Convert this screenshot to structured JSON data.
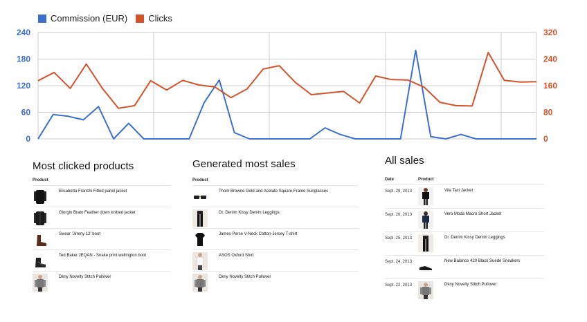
{
  "legend": {
    "commission_label": "Commission (EUR)",
    "clicks_label": "Clicks"
  },
  "colors": {
    "commission": "#3a6fd0",
    "clicks": "#d4522a",
    "grid": "#cccccc"
  },
  "chart_data": {
    "type": "line",
    "x": [
      0,
      1,
      2,
      3,
      4,
      5,
      6,
      7,
      8,
      9,
      10,
      11,
      12,
      13,
      14,
      15,
      16,
      17,
      18,
      19,
      20,
      21,
      22,
      23,
      24,
      25,
      26,
      27,
      28,
      29,
      30,
      31,
      32,
      33
    ],
    "series": [
      {
        "name": "Commission (EUR)",
        "axis": "left",
        "values": [
          0,
          55,
          51,
          43,
          73,
          0,
          35,
          0,
          0,
          0,
          0,
          82,
          133,
          14,
          0,
          0,
          0,
          0,
          0,
          25,
          10,
          0,
          0,
          0,
          0,
          200,
          5,
          0,
          10,
          0,
          0,
          0,
          0,
          0
        ]
      },
      {
        "name": "Clicks",
        "axis": "right",
        "values": [
          175,
          200,
          152,
          225,
          152,
          92,
          100,
          175,
          147,
          176,
          162,
          156,
          124,
          150,
          210,
          220,
          170,
          133,
          138,
          143,
          108,
          189,
          178,
          177,
          156,
          110,
          100,
          99,
          260,
          176,
          171,
          172
        ]
      }
    ],
    "left_axis": {
      "ticks": [
        "0",
        "60",
        "120",
        "180",
        "240"
      ],
      "ylim": [
        0,
        240
      ]
    },
    "right_axis": {
      "ticks": [
        "0",
        "80",
        "160",
        "240",
        "320"
      ],
      "ylim": [
        0,
        320
      ]
    },
    "grid": true,
    "legend_position": "top-left"
  },
  "most_clicked": {
    "title": "Most clicked products",
    "col_product": "Product",
    "items": [
      {
        "name": "Elisabetta Franchi Fitted panel jacket",
        "icon": "black-jacket-icon"
      },
      {
        "name": "Giorgio Brato Feather down knitted jacket",
        "icon": "black-knit-jacket-icon"
      },
      {
        "name": "Swear 'Jimmy 12' boot",
        "icon": "brown-boot-icon"
      },
      {
        "name": "Ted Baker JEQAN - Snake print wellington boot",
        "icon": "black-wellington-icon"
      },
      {
        "name": "Dkny Novelty Stitch Pullover",
        "icon": "grey-pullover-icon"
      }
    ]
  },
  "most_sales": {
    "title": "Generated most sales",
    "col_product": "Product",
    "items": [
      {
        "name": "Thom Browne Gold and Acetate Square-Frame Sunglasses",
        "icon": "sunglasses-icon"
      },
      {
        "name": "Dr. Denim Kissy Denim Leggings",
        "icon": "leggings-icon"
      },
      {
        "name": "James Perse V-Neck Cotton-Jersey T-shirt",
        "icon": "tshirt-icon"
      },
      {
        "name": "ASOS Oxford Shirt",
        "icon": "shirt-icon"
      },
      {
        "name": "Dkny Novelty Stitch Pullover",
        "icon": "grey-pullover-icon"
      }
    ]
  },
  "all_sales": {
    "title": "All sales",
    "col_date": "Date",
    "col_product": "Product",
    "items": [
      {
        "date": "Sept. 29, 2013",
        "name": "Vila Taci Jacket",
        "icon": "woman-jacket-icon"
      },
      {
        "date": "Sept. 26, 2013",
        "name": "Vero Moda Macro Short Jacket",
        "icon": "woman-blue-jacket-icon"
      },
      {
        "date": "Sept. 25, 2013",
        "name": "Dr. Denim Kissy Denim Leggings",
        "icon": "leggings-icon"
      },
      {
        "date": "Sept. 24, 2013",
        "name": "New Balance 420 Black Suede Sneakers",
        "icon": "sneaker-icon"
      },
      {
        "date": "Sept. 22, 2013",
        "name": "Dkny Novelty Stitch Pullover",
        "icon": "grey-pullover-icon"
      }
    ]
  }
}
